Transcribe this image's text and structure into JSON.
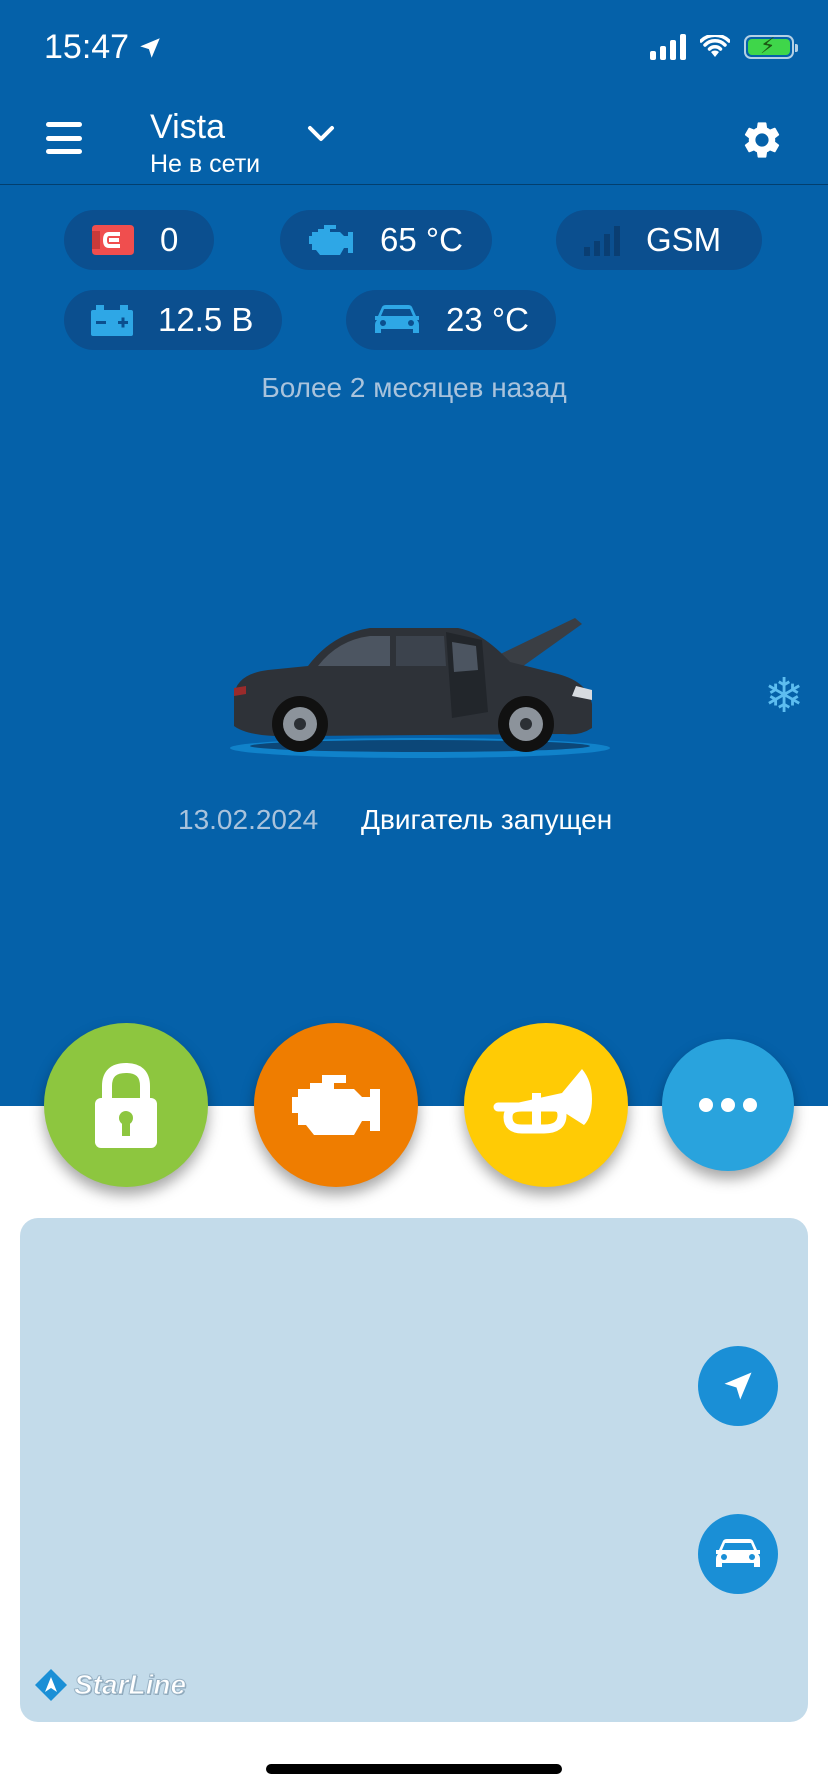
{
  "status_bar": {
    "time": "15:47"
  },
  "header": {
    "title": "Vista",
    "subtitle": "Не в сети"
  },
  "indicators": {
    "alarm_count": "0",
    "engine_temp": "65 °C",
    "gsm": "GSM",
    "battery_voltage": "12.5 В",
    "cabin_temp": "23 °C"
  },
  "last_update": "Более 2 месяцев назад",
  "event": {
    "date": "13.02.2024",
    "text": "Двигатель запущен"
  },
  "map": {
    "logo_text": "StarLine"
  },
  "colors": {
    "top_bg": "#0561a9",
    "chip_bg": "#0b4f8f",
    "lock": "#8dc63f",
    "engine": "#ef7d00",
    "horn": "#ffcb05",
    "more": "#29a3dd",
    "map_bg": "#c3dbea",
    "icon_blue": "#2ea7e6",
    "alarm_red": "#f04e4e"
  },
  "icons": [
    "location-arrow-icon",
    "signal-icon",
    "wifi-icon",
    "battery-icon",
    "hamburger-icon",
    "chevron-down-icon",
    "gear-icon",
    "alarm-icon",
    "engine-icon",
    "gsm-signal-icon",
    "car-battery-icon",
    "car-icon",
    "snowflake-icon",
    "lock-icon",
    "horn-icon",
    "more-icon",
    "navigation-icon",
    "car-locate-icon",
    "starline-logo-icon"
  ]
}
